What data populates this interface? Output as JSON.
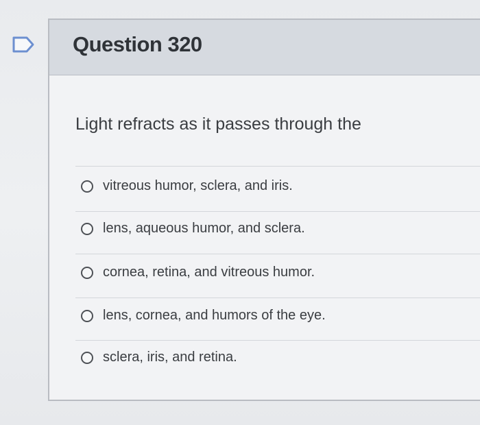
{
  "question": {
    "title": "Question 320",
    "prompt": "Light refracts as it passes through the"
  },
  "flag_icon": "bookmark-flag-icon",
  "options": [
    {
      "label": "vitreous humor, sclera, and iris.",
      "selected": false
    },
    {
      "label": "lens, aqueous humor, and sclera.",
      "selected": false
    },
    {
      "label": "cornea, retina, and vitreous humor.",
      "selected": false
    },
    {
      "label": "lens, cornea, and humors of the eye.",
      "selected": false
    },
    {
      "label": "sclera, iris, and retina.",
      "selected": false
    }
  ],
  "colors": {
    "header_bg": "#d6dae0",
    "card_bg": "#f2f3f5",
    "text": "#3a3d41"
  }
}
